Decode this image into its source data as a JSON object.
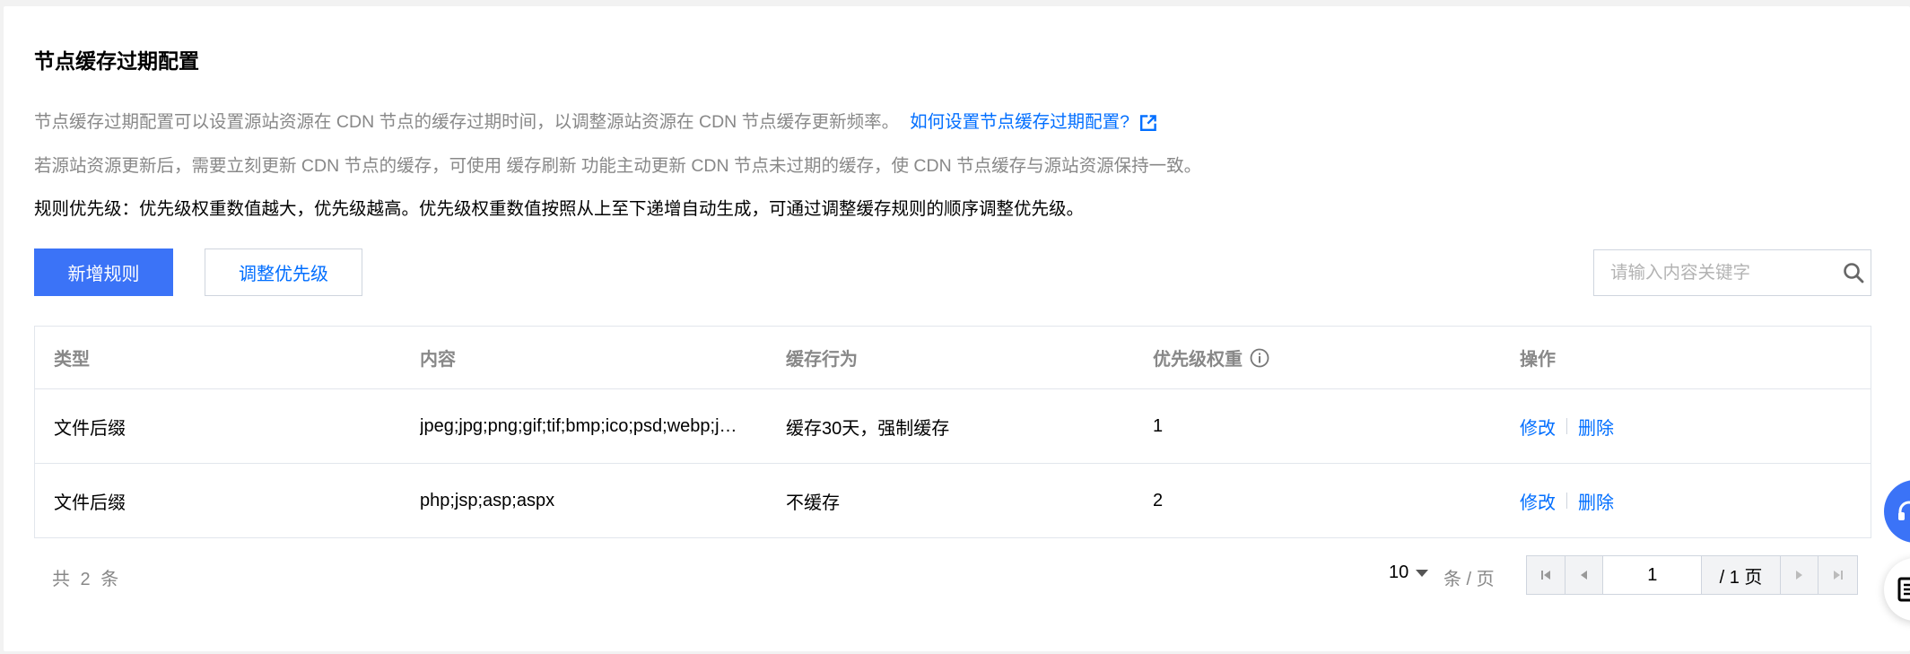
{
  "page": {
    "title": "节点缓存过期配置",
    "desc1": "节点缓存过期配置可以设置源站资源在 CDN 节点的缓存过期时间，以调整源站资源在 CDN 节点缓存更新频率。",
    "help_link": "如何设置节点缓存过期配置?",
    "desc2": "若源站资源更新后，需要立刻更新 CDN 节点的缓存，可使用 缓存刷新 功能主动更新 CDN 节点未过期的缓存，使 CDN 节点缓存与源站资源保持一致。",
    "desc3": "规则优先级：优先级权重数值越大，优先级越高。优先级权重数值按照从上至下递增自动生成，可通过调整缓存规则的顺序调整优先级。"
  },
  "toolbar": {
    "add_label": "新增规则",
    "adjust_label": "调整优先级",
    "search_placeholder": "请输入内容关键字"
  },
  "table": {
    "headers": [
      "类型",
      "内容",
      "缓存行为",
      "优先级权重",
      "操作"
    ],
    "rows": [
      {
        "type": "文件后缀",
        "content": "jpeg;jpg;png;gif;tif;bmp;ico;psd;webp;j…",
        "behavior": "缓存30天，强制缓存",
        "weight": "1",
        "edit": "修改",
        "delete": "删除"
      },
      {
        "type": "文件后缀",
        "content": "php;jsp;asp;aspx",
        "behavior": "不缓存",
        "weight": "2",
        "edit": "修改",
        "delete": "删除"
      }
    ]
  },
  "pagination": {
    "total": "共 2 条",
    "page_size": "10",
    "per_page": "条 / 页",
    "current_page": "1",
    "total_pages": "/ 1 页"
  },
  "colors": {
    "primary": "#3b73f7",
    "link": "#006eff"
  }
}
